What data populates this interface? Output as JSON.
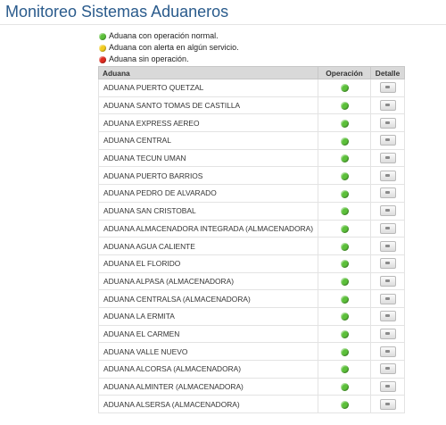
{
  "page": {
    "title": "Monitoreo Sistemas Aduaneros"
  },
  "legend": [
    {
      "label": "Aduana con operación normal.",
      "color": "#5cc03a"
    },
    {
      "label": "Aduana con alerta en algún servicio.",
      "color": "#f2cc1f"
    },
    {
      "label": "Aduana sin operación.",
      "color": "#e02b20"
    }
  ],
  "table": {
    "headers": {
      "name": "Aduana",
      "status": "Operación",
      "detail": "Detalle"
    },
    "rows": [
      {
        "name": "ADUANA PUERTO QUETZAL",
        "status": "normal"
      },
      {
        "name": "ADUANA SANTO TOMAS DE CASTILLA",
        "status": "normal"
      },
      {
        "name": "ADUANA EXPRESS AEREO",
        "status": "normal"
      },
      {
        "name": "ADUANA CENTRAL",
        "status": "normal"
      },
      {
        "name": "ADUANA TECUN UMAN",
        "status": "normal"
      },
      {
        "name": "ADUANA PUERTO BARRIOS",
        "status": "normal"
      },
      {
        "name": "ADUANA PEDRO DE ALVARADO",
        "status": "normal"
      },
      {
        "name": "ADUANA SAN CRISTOBAL",
        "status": "normal"
      },
      {
        "name": "ADUANA ALMACENADORA INTEGRADA (ALMACENADORA)",
        "status": "normal"
      },
      {
        "name": "ADUANA AGUA CALIENTE",
        "status": "normal"
      },
      {
        "name": "ADUANA EL FLORIDO",
        "status": "normal"
      },
      {
        "name": "ADUANA ALPASA (ALMACENADORA)",
        "status": "normal"
      },
      {
        "name": "ADUANA CENTRALSA (ALMACENADORA)",
        "status": "normal"
      },
      {
        "name": "ADUANA LA ERMITA",
        "status": "normal"
      },
      {
        "name": "ADUANA EL CARMEN",
        "status": "normal"
      },
      {
        "name": "ADUANA VALLE NUEVO",
        "status": "normal"
      },
      {
        "name": "ADUANA ALCORSA (ALMACENADORA)",
        "status": "normal"
      },
      {
        "name": "ADUANA ALMINTER (ALMACENADORA)",
        "status": "normal"
      },
      {
        "name": "ADUANA ALSERSA (ALMACENADORA)",
        "status": "normal"
      }
    ]
  }
}
